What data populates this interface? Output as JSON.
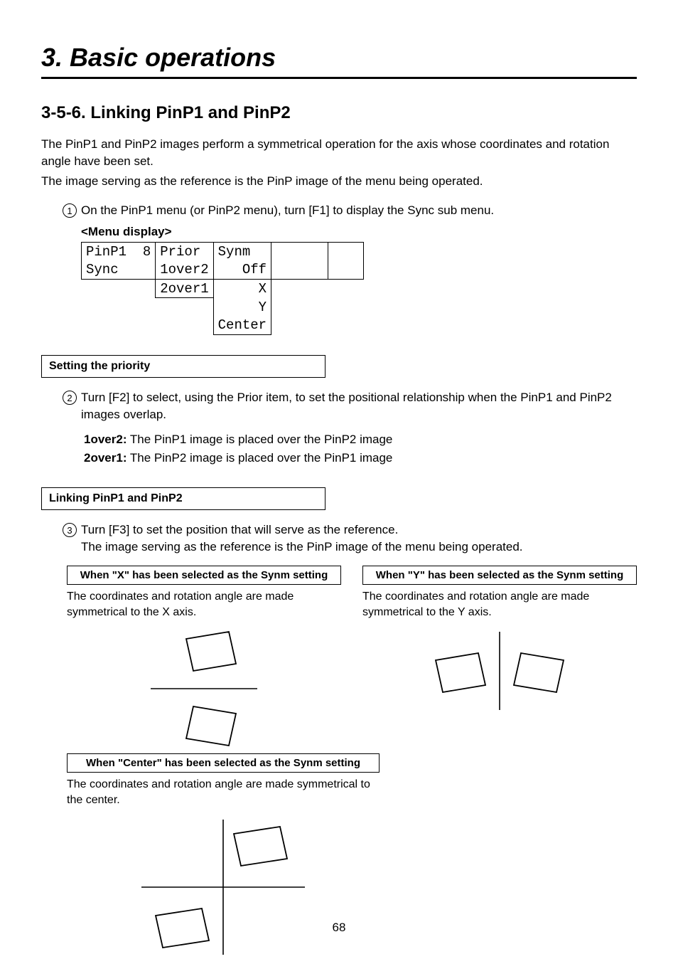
{
  "chapter_title": "3. Basic operations",
  "section_title": "3-5-6. Linking PinP1 and PinP2",
  "intro_para_1": "The PinP1 and PinP2 images perform a symmetrical operation for the axis whose coordinates and rotation angle have been set.",
  "intro_para_2": "The image serving as the reference is the PinP image of the menu being operated.",
  "step1_num": "1",
  "step1_text": "On the PinP1 menu (or PinP2 menu), turn [F1] to display the Sync sub menu.",
  "menu_display_label": "<Menu display>",
  "menu": {
    "r1c1": "PinP1  8",
    "r1c2": "Prior ",
    "r1c3": "Synm  ",
    "r2c1": "Sync    ",
    "r2c2": "1over2",
    "r2c3": "Off",
    "r3c2": "2over1",
    "r3c3": "X",
    "r4c3": "Y",
    "r5c3": "Center"
  },
  "priority_box": "Setting the priority",
  "step2_num": "2",
  "step2_text": "Turn [F2] to select, using the Prior item, to set the positional relationship when the PinP1 and PinP2 images overlap.",
  "def1_term": "1over2:",
  "def1_text": " The PinP1 image is placed over the PinP2 image",
  "def2_term": "2over1:",
  "def2_text": " The PinP2 image is placed over the PinP1 image",
  "linking_box": "Linking PinP1 and PinP2",
  "step3_num": "3",
  "step3_text_a": "Turn [F3] to set the position that will serve as the reference.",
  "step3_text_b": "The image serving as the reference is the PinP image of the menu being operated.",
  "synm_x_head": "When \"X\" has been selected as the Synm setting",
  "synm_x_body": "The coordinates and rotation angle are made symmetrical to the X axis.",
  "synm_y_head": "When \"Y\" has been selected as the Synm setting",
  "synm_y_body": "The coordinates and rotation angle are made symmetrical to the Y axis.",
  "synm_c_head": "When \"Center\" has been selected as the Synm setting",
  "synm_c_body": "The coordinates and rotation angle are made symmetrical to the center.",
  "page_number": "68"
}
